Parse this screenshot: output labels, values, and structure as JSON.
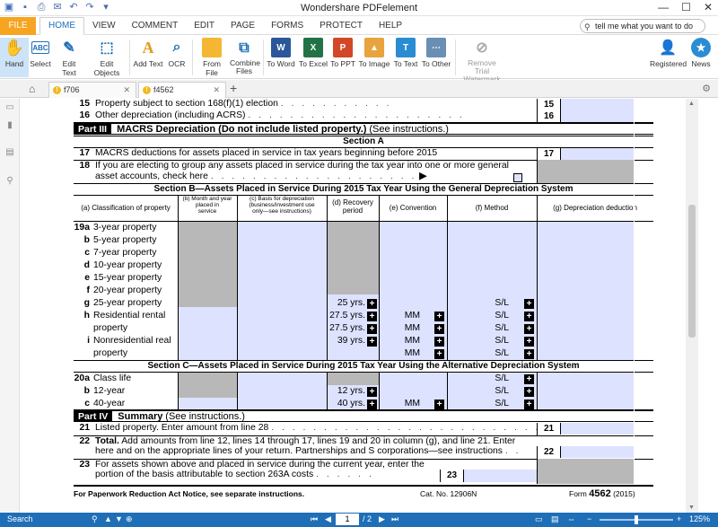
{
  "app": {
    "title": "Wondershare PDFelement",
    "window_controls": [
      "—",
      "☐",
      "✕"
    ]
  },
  "menu": {
    "file": "FILE",
    "tabs": [
      "HOME",
      "VIEW",
      "COMMENT",
      "EDIT",
      "PAGE",
      "FORMS",
      "PROTECT",
      "HELP"
    ],
    "search_placeholder": "tell me what you want to do"
  },
  "ribbon": {
    "hand": "Hand",
    "select": "Select",
    "edit_text": "Edit Text",
    "edit_objects": "Edit Objects",
    "add_text": "Add Text",
    "ocr": "OCR",
    "from_file": "From File",
    "combine_files_1": "Combine",
    "combine_files_2": "Files",
    "to_word": "To Word",
    "to_excel": "To Excel",
    "to_ppt": "To PPT",
    "to_image": "To Image",
    "to_text": "To Text",
    "to_other": "To Other",
    "remove_watermark_1": "Remove",
    "remove_watermark_2": "Trial Watermark",
    "registered": "Registered",
    "news": "News",
    "colors": {
      "accent": "#1f6fb8",
      "file": "#f7a421",
      "word": "#2b579a",
      "excel": "#217346",
      "ppt": "#d24726",
      "image": "#e8a33d",
      "text": "#2a8dd4",
      "other": "#6a8fb5"
    }
  },
  "doc_tabs": [
    {
      "name": "f706"
    },
    {
      "name": "f4562"
    }
  ],
  "form": {
    "line15": {
      "num": "15",
      "text": "Property subject to section 168(f)(1) election",
      "box": "15"
    },
    "line16": {
      "num": "16",
      "text": "Other depreciation (including ACRS)",
      "box": "16"
    },
    "part3": {
      "label": "Part III",
      "title": "MACRS Depreciation (Do not",
      "title2": "include listed property.)",
      "note": "(See instructions.)"
    },
    "section_a": "Section A",
    "line17": {
      "num": "17",
      "text": "MACRS deductions for assets placed in service in tax years beginning before 2015",
      "box": "17"
    },
    "line18": {
      "num": "18",
      "text": "If you are electing to group any assets placed in service during the tax year into one or more general",
      "text2": "asset accounts, check here",
      "arrow": "▶"
    },
    "section_b": "Section B—Assets Placed in Service During 2015 Tax Year Using the General Depreciation System",
    "columns": {
      "a": "(a) Classification of property",
      "b1": "(b) Month and year",
      "b2": "placed in",
      "b3": "service",
      "c1": "(c) Basis for depreciation",
      "c2": "(business/investment use",
      "c3": "only—see instructions)",
      "d1": "(d) Recovery",
      "d2": "period",
      "e": "(e) Convention",
      "f": "(f) Method",
      "g": "(g) Depreciation deduction"
    },
    "rows19": [
      {
        "letter": "19a",
        "label": "3-year property"
      },
      {
        "letter": "b",
        "label": "5-year property"
      },
      {
        "letter": "c",
        "label": "7-year property"
      },
      {
        "letter": "d",
        "label": "10-year property"
      },
      {
        "letter": "e",
        "label": "15-year property"
      },
      {
        "letter": "f",
        "label": "20-year property"
      },
      {
        "letter": "g",
        "label": "25-year property",
        "d": "25 yrs.",
        "f": "S/L"
      },
      {
        "letter": "h",
        "label": "Residential rental",
        "d": "27.5 yrs.",
        "e": "MM",
        "f": "S/L"
      },
      {
        "letter": "",
        "label": "property",
        "d": "27.5 yrs.",
        "e": "MM",
        "f": "S/L"
      },
      {
        "letter": "i",
        "label": "Nonresidential real",
        "d": "39 yrs.",
        "e": "MM",
        "f": "S/L"
      },
      {
        "letter": "",
        "label": "property",
        "e": "MM",
        "f": "S/L"
      }
    ],
    "section_c": "Section C—Assets Placed in Service During 2015 Tax Year Using the Alternative Depreciation System",
    "rows20": [
      {
        "letter": "20a",
        "label": "Class life",
        "f": "S/L"
      },
      {
        "letter": "b",
        "label": "12-year",
        "d": "12 yrs.",
        "f": "S/L"
      },
      {
        "letter": "c",
        "label": "40-year",
        "d": "40 yrs.",
        "e": "MM",
        "f": "S/L"
      }
    ],
    "part4": {
      "label": "Part IV",
      "title": "Summary",
      "note": "(See instructions.)"
    },
    "line21": {
      "num": "21",
      "text": "Listed property. Enter amount from line 28",
      "box": "21"
    },
    "line22": {
      "num": "22",
      "text_b": "Total.",
      "text": " Add amounts from line 12, lines 14 through 17, lines 19 and 20 in column (g), and line 21. Enter",
      "text2": "here and on the appropriate lines of your return. Partnerships and S corporations—see instructions",
      "box": "22"
    },
    "line23": {
      "num": "23",
      "text": "For assets shown above and placed in service during the current year, enter the",
      "text2": "portion of the basis attributable to section 263A costs",
      "box": "23"
    },
    "footer": {
      "left": "For Paperwork Reduction Act Notice, see separate instructions.",
      "cat": "Cat. No. 12906N",
      "form_prefix": "Form",
      "form_num": "4562",
      "year": "(2015)"
    }
  },
  "status": {
    "search": "Search",
    "page_current": "1",
    "page_total": "/ 2",
    "zoom": "125%"
  }
}
